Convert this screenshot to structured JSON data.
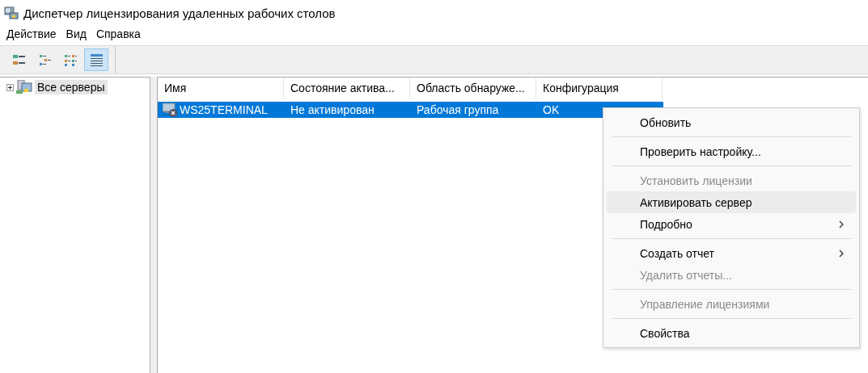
{
  "window": {
    "title": "Диспетчер лицензирования удаленных рабочих столов"
  },
  "menubar": [
    "Действие",
    "Вид",
    "Справка"
  ],
  "toolbar": [
    {
      "kind": "large",
      "selected": false
    },
    {
      "kind": "small",
      "selected": false
    },
    {
      "kind": "list",
      "selected": false
    },
    {
      "kind": "details",
      "selected": true
    }
  ],
  "tree": {
    "items": [
      {
        "label": "Все серверы",
        "expanded": false,
        "selected": true
      }
    ]
  },
  "table": {
    "columns": [
      "Имя",
      "Состояние актива...",
      "Область обнаруже...",
      "Конфигурация"
    ],
    "rows": [
      {
        "cells": [
          "WS25TERMINAL",
          "Не активирован",
          "Рабочая группа",
          "OK"
        ],
        "selected": true
      }
    ]
  },
  "context_menu": {
    "items": [
      {
        "kind": "item",
        "label": "Обновить",
        "disabled": false,
        "selected": false,
        "submenu": false
      },
      {
        "kind": "separator"
      },
      {
        "kind": "item",
        "label": "Проверить настройку...",
        "disabled": false,
        "selected": false,
        "submenu": false
      },
      {
        "kind": "separator"
      },
      {
        "kind": "item",
        "label": "Установить лицензии",
        "disabled": true,
        "selected": false,
        "submenu": false
      },
      {
        "kind": "item",
        "label": "Активировать сервер",
        "disabled": false,
        "selected": true,
        "submenu": false
      },
      {
        "kind": "item",
        "label": "Подробно",
        "disabled": false,
        "selected": false,
        "submenu": true
      },
      {
        "kind": "separator"
      },
      {
        "kind": "item",
        "label": "Создать отчет",
        "disabled": false,
        "selected": false,
        "submenu": true
      },
      {
        "kind": "item",
        "label": "Удалить отчеты...",
        "disabled": true,
        "selected": false,
        "submenu": false
      },
      {
        "kind": "separator"
      },
      {
        "kind": "item",
        "label": "Управление лицензиями",
        "disabled": true,
        "selected": false,
        "submenu": false
      },
      {
        "kind": "separator"
      },
      {
        "kind": "item",
        "label": "Свойства",
        "disabled": false,
        "selected": false,
        "submenu": false
      }
    ]
  }
}
